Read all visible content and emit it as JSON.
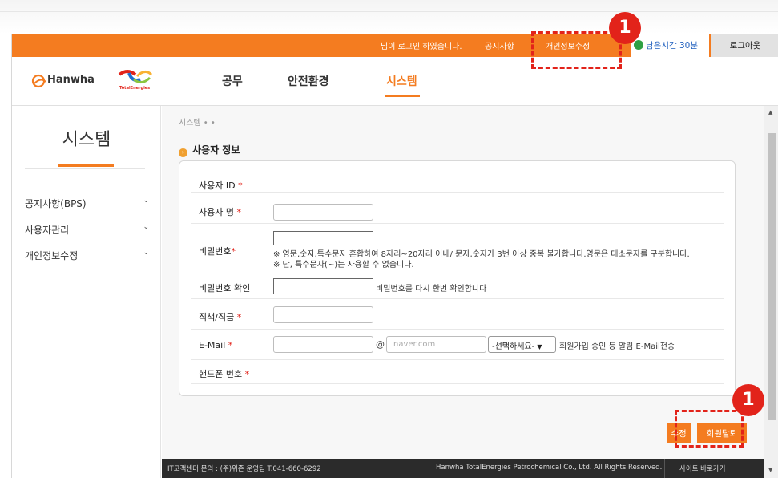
{
  "topbar": {
    "login_msg": "님이 로그인 하였습니다.",
    "notice": "공지사항",
    "profile_edit": "개인정보수정",
    "timer": "남은시간 30분",
    "logout": "로그아웃"
  },
  "logo": {
    "hanwha": "Hanwha",
    "te_text": "TotalEnergies"
  },
  "nav": [
    "공무",
    "안전환경",
    "시스템"
  ],
  "sidebar": {
    "title": "시스템",
    "items": [
      {
        "label": "공지사항(BPS)"
      },
      {
        "label": "사용자관리"
      },
      {
        "label": "개인정보수정"
      }
    ]
  },
  "breadcrumb": "시스템  •  •",
  "section_title": "사용자 정보",
  "form": {
    "user_id": "사용자 ID",
    "user_name": "사용자 명",
    "password": "비밀번호",
    "pw_note1": "※ 영문,숫자,특수문자 혼합하여 8자리~20자리 이내/ 문자,숫자가 3번 이상 중복 불가합니다.영문은 대소문자를 구분합니다.",
    "pw_note2": "※ 단, 특수문자(~)는 사용할 수 없습니다.",
    "pw_confirm": "비밀번호 확인",
    "pw_confirm_note": "비밀번호를 다시 한번 확인합니다",
    "position": "직책/직급",
    "email": "E-Mail",
    "at": "@",
    "domain_placeholder": "naver.com",
    "select_label": "-선택하세요-",
    "email_note": "회원가입 승인 등 알림 E-Mail전송",
    "phone": "핸드폰 번호",
    "required_mark": "*"
  },
  "buttons": {
    "edit": "수정",
    "withdraw": "회원탈퇴"
  },
  "footer": {
    "contact": "IT고객센터 문의 : (주)위존 운영팀 T.041-660-6292",
    "copyright": "Hanwha TotalEnergies Petrochemical Co., Ltd. All Rights Reserved.",
    "site_link": "사이트 바로가기"
  },
  "annotations": {
    "badge1": "1",
    "badge2": "1"
  },
  "colors": {
    "accent": "#f47c20",
    "annotation": "#e2231a",
    "timer_dot": "#2ea043",
    "timer_text": "#1f5fbf"
  }
}
